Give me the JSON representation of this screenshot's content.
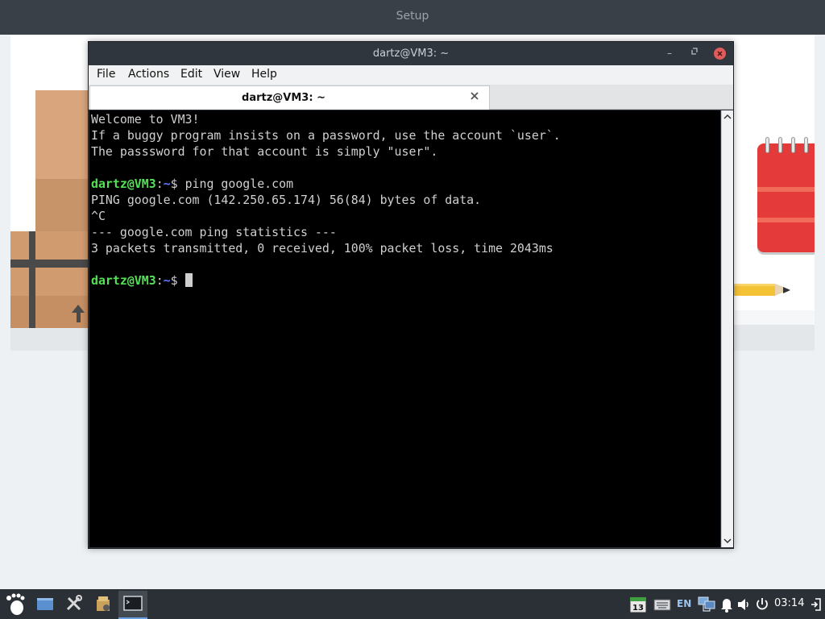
{
  "setup": {
    "title": "Setup"
  },
  "terminal": {
    "window_title": "dartz@VM3: ~",
    "menu": [
      "File",
      "Actions",
      "Edit",
      "View",
      "Help"
    ],
    "tab_label": "dartz@VM3: ~",
    "lines": [
      {
        "text": "Welcome to VM3!"
      },
      {
        "text": "If a buggy program insists on a password, use the account `user`."
      },
      {
        "text": "The passsword for that account is simply \"user\"."
      },
      {
        "text": ""
      },
      {
        "prompt_user": "dartz@VM3",
        "prompt_path": "~",
        "prompt_end": "$ ",
        "text": "ping google.com"
      },
      {
        "text": "PING google.com (142.250.65.174) 56(84) bytes of data."
      },
      {
        "text": "^C"
      },
      {
        "text": "--- google.com ping statistics ---"
      },
      {
        "text": "3 packets transmitted, 0 received, 100% packet loss, time 2043ms"
      },
      {
        "text": ""
      },
      {
        "prompt_user": "dartz@VM3",
        "prompt_path": "~",
        "prompt_end": "$ ",
        "text": "",
        "cursor": true
      }
    ]
  },
  "taskbar": {
    "tray": {
      "language": "EN",
      "clock": "03:14",
      "calendar_day": "13"
    }
  },
  "colors": {
    "prompt_user": "#55e055",
    "prompt_path": "#5b7cff",
    "close_button": "#e05b5b"
  }
}
